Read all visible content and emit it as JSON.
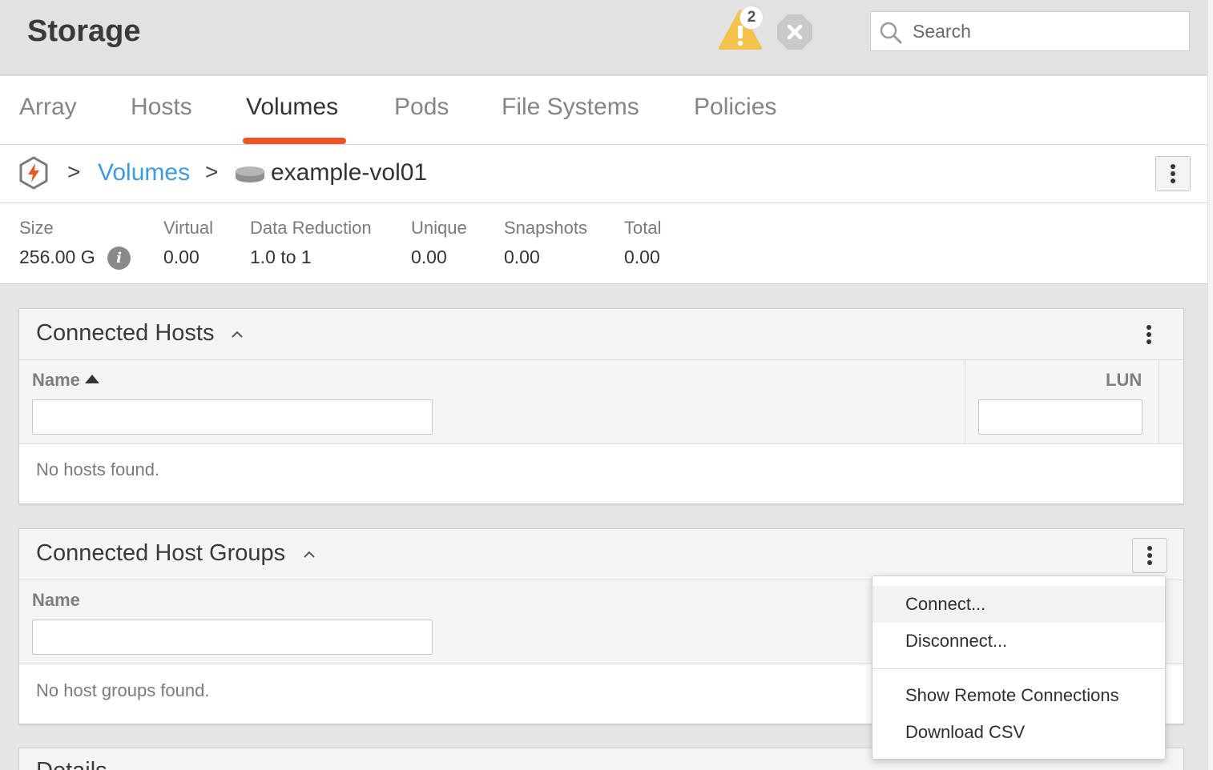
{
  "header": {
    "title": "Storage",
    "alert_count": "2",
    "search_placeholder": "Search",
    "colors": {
      "warning": "#f4c44a",
      "close_bg": "#c9c9c9"
    }
  },
  "tabs": [
    {
      "label": "Array"
    },
    {
      "label": "Hosts"
    },
    {
      "label": "Volumes",
      "active": true
    },
    {
      "label": "Pods"
    },
    {
      "label": "File Systems"
    },
    {
      "label": "Policies"
    }
  ],
  "accent_color": "#e8562a",
  "breadcrumb": {
    "sep": ">",
    "parent": "Volumes",
    "current": "example-vol01"
  },
  "stats": {
    "size": {
      "label": "Size",
      "value": "256.00 G"
    },
    "virtual": {
      "label": "Virtual",
      "value": "0.00"
    },
    "data_reduction": {
      "label": "Data Reduction",
      "value": "1.0 to 1"
    },
    "unique": {
      "label": "Unique",
      "value": "0.00"
    },
    "snapshots": {
      "label": "Snapshots",
      "value": "0.00"
    },
    "total": {
      "label": "Total",
      "value": "0.00"
    },
    "info_glyph": "i"
  },
  "connected_hosts": {
    "title": "Connected Hosts",
    "col_name": "Name",
    "col_lun": "LUN",
    "empty": "No hosts found."
  },
  "connected_host_groups": {
    "title": "Connected Host Groups",
    "col_name": "Name",
    "empty": "No host groups found."
  },
  "details": {
    "title": "Details"
  },
  "menu": {
    "items": [
      {
        "label": "Connect..."
      },
      {
        "label": "Disconnect..."
      },
      {
        "label": "Show Remote Connections"
      },
      {
        "label": "Download CSV"
      }
    ]
  }
}
